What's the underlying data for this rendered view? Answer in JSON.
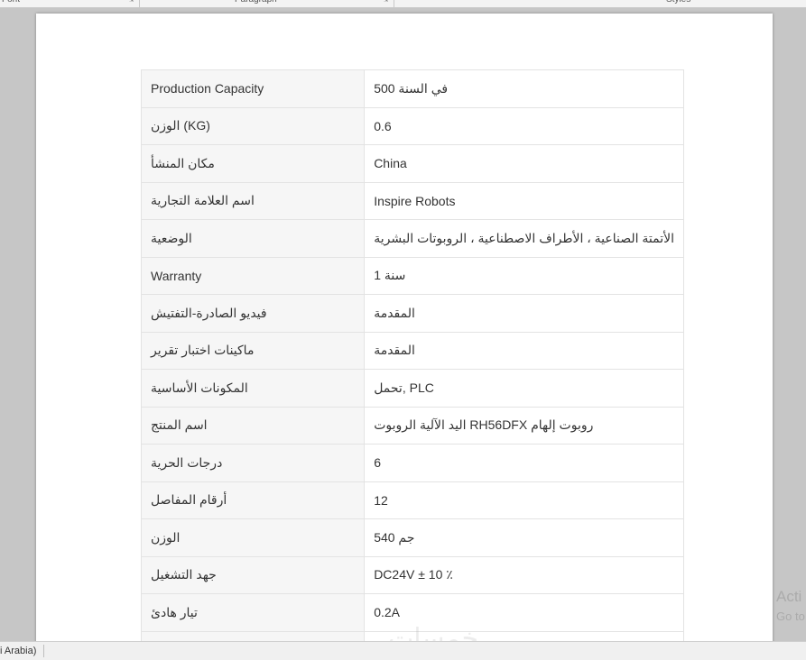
{
  "ribbon": {
    "groups": [
      "Font",
      "Paragraph",
      "Styles"
    ]
  },
  "table": {
    "rows": [
      {
        "key": "Production Capacity",
        "value": "في السنة 500"
      },
      {
        "key": "الوزن (KG)",
        "value": "0.6"
      },
      {
        "key": "مكان المنشأ",
        "value": "China"
      },
      {
        "key": "اسم العلامة التجارية",
        "value": "Inspire Robots"
      },
      {
        "key": "الوضعية",
        "value": "الأتمتة الصناعية ، الأطراف الاصطناعية ، الروبوتات البشرية"
      },
      {
        "key": "Warranty",
        "value": "سنة 1"
      },
      {
        "key": "فيديو الصادرة-التفتيش",
        "value": "المقدمة"
      },
      {
        "key": "ماكينات اختبار تقرير",
        "value": "المقدمة"
      },
      {
        "key": "المكونات الأساسية",
        "value": "تحمل, PLC"
      },
      {
        "key": "اسم المنتج",
        "value": "اليد الآلية الروبوت RH56DFX روبوت إلهام"
      },
      {
        "key": "درجات الحرية",
        "value": "6"
      },
      {
        "key": "أرقام المفاصل",
        "value": "12"
      },
      {
        "key": "الوزن",
        "value": "جم 540"
      },
      {
        "key": "جهد التشغيل",
        "value": "DC24V ± 10 ٪"
      },
      {
        "key": "تيار هادئ",
        "value": "0.2A"
      },
      {
        "key": "",
        "value": ""
      }
    ]
  },
  "watermark": "خمسات",
  "activation": {
    "title": "Acti",
    "subtitle": "Go to"
  },
  "status_bar": {
    "language": "i Arabia)"
  }
}
